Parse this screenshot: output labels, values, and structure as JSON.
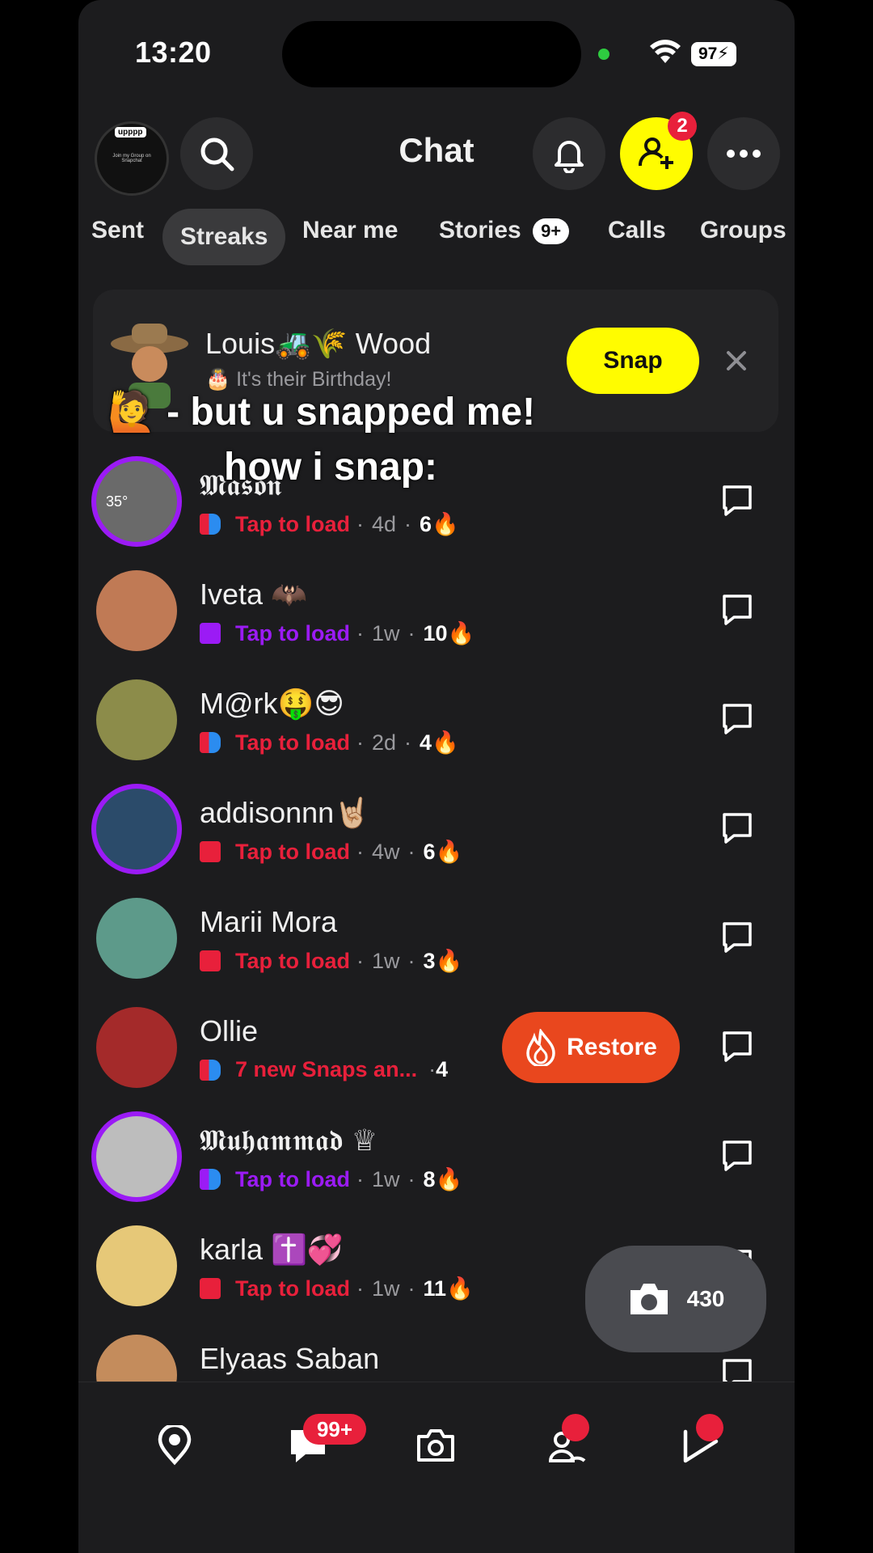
{
  "status": {
    "time": "13:20",
    "battery": "97"
  },
  "header": {
    "title": "Chat",
    "friend_requests_badge": "2",
    "group_banner_text": "Join my Group on Snapchat",
    "group_tag": "upppp"
  },
  "tabs": [
    {
      "label": "Sent"
    },
    {
      "label": "Streaks",
      "active": true
    },
    {
      "label": "Near me"
    },
    {
      "label": "Stories",
      "badge": "9+"
    },
    {
      "label": "Calls"
    },
    {
      "label": "Groups"
    }
  ],
  "birthday_card": {
    "name": "Louis🚜🌾 Wood",
    "subtitle": "🎂 It's their Birthday!",
    "action": "Snap"
  },
  "caption": {
    "line1": "🙋 - but u snapped me!",
    "line2": "how i snap:"
  },
  "chats": [
    {
      "name": "𝕸𝖆𝖘𝖔𝖓",
      "status": "Tap to load",
      "status_color": "#e8203b",
      "icon": "red-blue-chat-icon",
      "time": "4d",
      "streak": "6🔥",
      "ring": true,
      "temp": "35°"
    },
    {
      "name": "Iveta 🦇",
      "status": "Tap to load",
      "status_color": "#9b1bf5",
      "icon": "purple-square-icon",
      "time": "1w",
      "streak": "10🔥",
      "ring": false
    },
    {
      "name": "M@rk🤑😎",
      "status": "Tap to load",
      "status_color": "#e8203b",
      "icon": "red-blue-chat-icon",
      "time": "2d",
      "streak": "4🔥",
      "ring": false
    },
    {
      "name": "addisonnn🤘🏼",
      "status": "Tap to load",
      "status_color": "#e8203b",
      "icon": "red-square-icon",
      "time": "4w",
      "streak": "6🔥",
      "ring": true
    },
    {
      "name": "Marii Mora",
      "status": "Tap to load",
      "status_color": "#e8203b",
      "icon": "red-square-icon",
      "time": "1w",
      "streak": "3🔥",
      "ring": false
    },
    {
      "name": "Ollie",
      "status": "7 new Snaps an...",
      "status_color": "#e8203b",
      "icon": "red-blue-chat-icon",
      "time": "",
      "streak": "4",
      "ring": false
    },
    {
      "name": "𝕸𝖚𝖍𝖆𝖒𝖒𝖆𝖉 ♕",
      "status": "Tap to load",
      "status_color": "#9b1bf5",
      "icon": "purple-blue-chat-icon",
      "time": "1w",
      "streak": "8🔥",
      "ring": true
    },
    {
      "name": "karla ✝️💞",
      "status": "Tap to load",
      "status_color": "#e8203b",
      "icon": "red-square-icon",
      "time": "1w",
      "streak": "11🔥",
      "ring": false
    },
    {
      "name": "Elyaas Saban",
      "status": "",
      "status_color": "#e8203b",
      "icon": "",
      "time": "",
      "streak": "",
      "ring": false
    }
  ],
  "restore_button": "Restore",
  "camera_fab": {
    "count": "430"
  },
  "bottom_nav": {
    "chat_badge": "99+",
    "items": [
      "map-icon",
      "chat-icon",
      "camera-icon",
      "friends-icon",
      "stories-icon"
    ]
  },
  "colors": {
    "snap_yellow": "#fffc00",
    "red": "#e8203b",
    "purple": "#9b1bf5",
    "orange": "#e9471e"
  }
}
